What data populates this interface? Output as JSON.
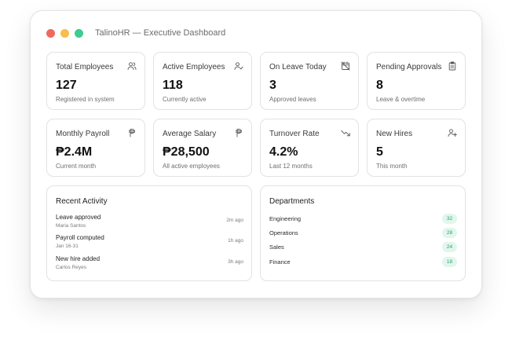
{
  "window": {
    "title": "TalinoHR — Executive Dashboard",
    "controls": {
      "close_color": "#ee6a5f",
      "minimize_color": "#f5be4f",
      "maximize_color": "#3dcc91"
    }
  },
  "stats": [
    {
      "label": "Total Employees",
      "value": "127",
      "sub": "Registered in system",
      "icon": "users-icon"
    },
    {
      "label": "Active Employees",
      "value": "118",
      "sub": "Currently active",
      "icon": "user-check-icon"
    },
    {
      "label": "On Leave Today",
      "value": "3",
      "sub": "Approved leaves",
      "icon": "calendar-off-icon"
    },
    {
      "label": "Pending Approvals",
      "value": "8",
      "sub": "Leave & overtime",
      "icon": "clipboard-icon"
    },
    {
      "label": "Monthly Payroll",
      "value": "₱2.4M",
      "sub": "Current month",
      "icon": "peso-icon"
    },
    {
      "label": "Average Salary",
      "value": "₱28,500",
      "sub": "All active employees",
      "icon": "peso-icon"
    },
    {
      "label": "Turnover Rate",
      "value": "4.2%",
      "sub": "Last 12 months",
      "icon": "trending-down-icon"
    },
    {
      "label": "New Hires",
      "value": "5",
      "sub": "This month",
      "icon": "user-plus-icon"
    }
  ],
  "recent_activity": {
    "title": "Recent Activity",
    "items": [
      {
        "title": "Leave approved",
        "sub": "Maria Santos",
        "time": "2m ago"
      },
      {
        "title": "Payroll computed",
        "sub": "Jan 16-31",
        "time": "1h ago"
      },
      {
        "title": "New hire added",
        "sub": "Carlos Reyes",
        "time": "3h ago"
      }
    ]
  },
  "departments": {
    "title": "Departments",
    "items": [
      {
        "name": "Engineering",
        "count": "32"
      },
      {
        "name": "Operations",
        "count": "28"
      },
      {
        "name": "Sales",
        "count": "24"
      },
      {
        "name": "Finance",
        "count": "18"
      }
    ],
    "badge_bg": "#e1f6ec",
    "badge_fg": "#2f9e6c"
  }
}
